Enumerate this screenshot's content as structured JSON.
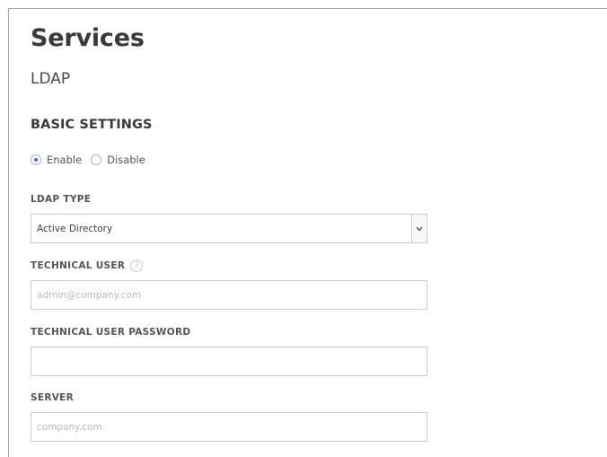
{
  "page": {
    "title": "Services",
    "subtitle": "LDAP"
  },
  "basic_settings": {
    "heading": "BASIC SETTINGS",
    "radios": [
      {
        "label": "Enable",
        "checked": true
      },
      {
        "label": "Disable",
        "checked": false
      }
    ]
  },
  "fields": {
    "ldap_type": {
      "label": "LDAP TYPE",
      "value": "Active Directory",
      "arrow_icon": "chevron-down-icon"
    },
    "technical_user": {
      "label": "TECHNICAL USER",
      "help_icon": "help-icon",
      "help_glyph": "?",
      "placeholder": "admin@company.com",
      "value": ""
    },
    "technical_user_password": {
      "label": "TECHNICAL USER PASSWORD",
      "value": ""
    },
    "server": {
      "label": "SERVER",
      "placeholder": "company.com",
      "value": ""
    }
  },
  "colors": {
    "accent": "#4a6fa5",
    "border": "#c6ced6",
    "frame_border": "#9aa9b6"
  }
}
